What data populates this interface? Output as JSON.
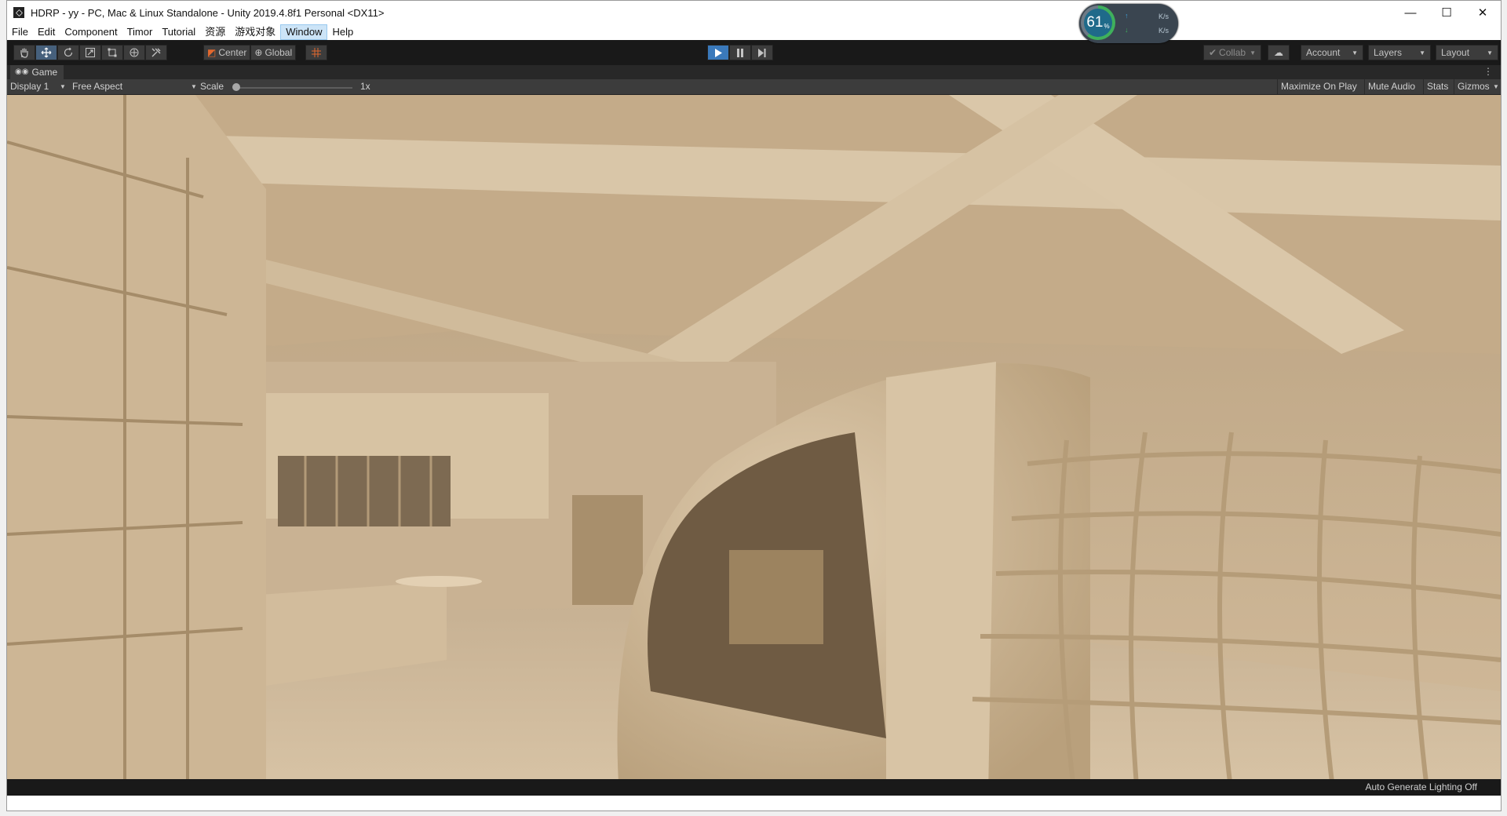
{
  "window": {
    "title": "HDRP - yy - PC, Mac & Linux Standalone - Unity 2019.4.8f1 Personal <DX11>",
    "controls": {
      "minimize": "—",
      "maximize": "☐",
      "close": "✕"
    }
  },
  "perf_monitor": {
    "percent": "61",
    "percent_unit": "%",
    "upload": "K/s",
    "download": "K/s",
    "percent_value": 61
  },
  "menu": {
    "items": [
      "File",
      "Edit",
      "Component",
      "Timor",
      "Tutorial",
      "资源",
      "游戏对象",
      "Window",
      "Help"
    ],
    "active": "Window"
  },
  "toolbar": {
    "tools": [
      "hand-tool-icon",
      "move-tool-icon",
      "rotate-tool-icon",
      "scale-tool-icon",
      "rect-tool-icon",
      "transform-tool-icon",
      "custom-tool-icon"
    ],
    "pivot_mode": "Center",
    "pivot_rotation": "Global",
    "collab": "Collab",
    "account": "Account",
    "layers": "Layers",
    "layout": "Layout"
  },
  "game_view": {
    "tab_label": "Game",
    "display": "Display 1",
    "aspect": "Free Aspect",
    "scale_label": "Scale",
    "scale_value": "1x",
    "maximize_on_play": "Maximize On Play",
    "mute_audio": "Mute Audio",
    "stats": "Stats",
    "gizmos": "Gizmos"
  },
  "status": {
    "lighting": "Auto Generate Lighting Off"
  },
  "colors": {
    "toolbar_bg": "#191919",
    "panel_bg": "#3c3c3c",
    "play_active": "#3a79bb",
    "scene_tint": "#cbb498"
  }
}
